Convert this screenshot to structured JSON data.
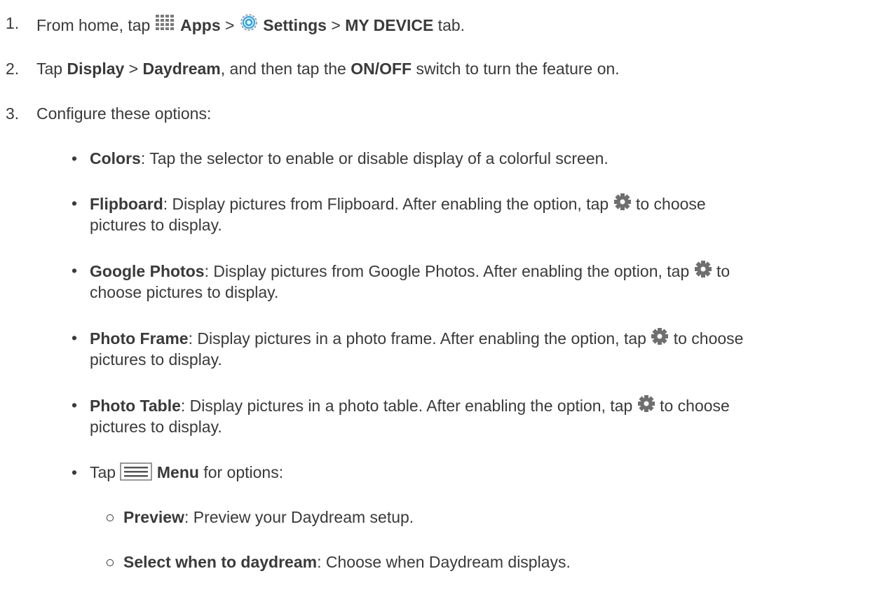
{
  "steps": [
    {
      "num": "1.",
      "pre": "From home, tap ",
      "apps_label": "Apps",
      "sep1": " > ",
      "settings_label": "Settings",
      "sep2": " > ",
      "tab_label": "MY DEVICE",
      "post": " tab."
    },
    {
      "num": "2.",
      "pre": "Tap ",
      "display_label": "Display",
      "sep1": " > ",
      "daydream_label": "Daydream",
      "mid": ", and then tap the ",
      "switch_label": "ON/OFF",
      "post": " switch to turn the feature on."
    },
    {
      "num": "3.",
      "text": "Configure these options:"
    }
  ],
  "options": [
    {
      "title": "Colors",
      "desc": ": Tap the selector to enable or disable display of a colorful screen."
    },
    {
      "title": "Flipboard",
      "desc": ": Display pictures from Flipboard. After enabling the option, tap ",
      "desc2": " to choose",
      "line2": "pictures to display."
    },
    {
      "title": "Google Photos",
      "desc": ": Display pictures from Google Photos. After enabling the option, tap ",
      "desc2": " to",
      "line2": "choose pictures to display."
    },
    {
      "title": "Photo Frame",
      "desc": ": Display pictures in a photo frame. After enabling the option, tap ",
      "desc2": " to choose",
      "line2": "pictures to display."
    },
    {
      "title": "Photo Table",
      "desc": ": Display pictures in a photo table. After enabling the option, tap ",
      "desc2": " to choose",
      "line2": "pictures to display."
    }
  ],
  "menu": {
    "pre": "Tap ",
    "label": "Menu",
    "post": " for options:"
  },
  "menu_options": [
    {
      "title": "Preview",
      "desc": ": Preview your Daydream setup."
    },
    {
      "title": "Select when to daydream",
      "desc": ": Choose when Daydream displays."
    }
  ],
  "icons": {
    "apps": "apps-grid-icon",
    "settings": "settings-gear-icon",
    "gear": "gear-icon",
    "menu": "menu-icon"
  },
  "colors": {
    "text": "#3a3a3a",
    "settings_blue": "#29a3e0",
    "icon_gray": "#6f6f6f"
  }
}
